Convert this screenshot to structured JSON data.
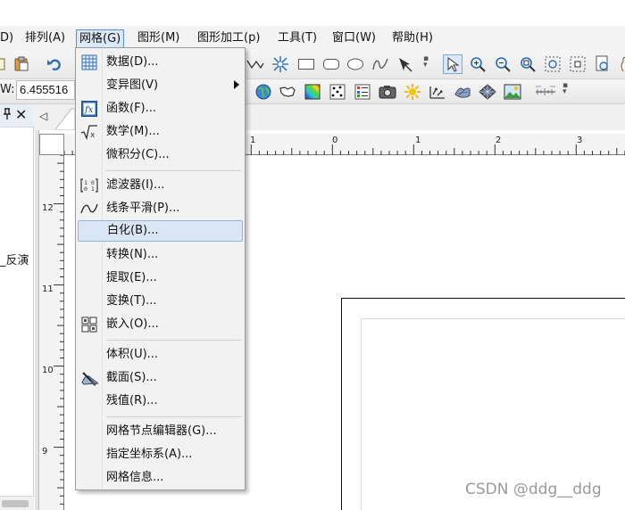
{
  "menubar": {
    "items": [
      {
        "label": "D)",
        "key": "partial"
      },
      {
        "label": "排列(A)"
      },
      {
        "label": "网格(G)"
      },
      {
        "label": "图形(M)"
      },
      {
        "label": "图形加工(p)"
      },
      {
        "label": "工具(T)"
      },
      {
        "label": "窗口(W)"
      },
      {
        "label": "帮助(H)"
      }
    ]
  },
  "toolbar": {
    "w_label": "W:",
    "w_value": "6.455516"
  },
  "left_panel": {
    "visible_text": "_反演"
  },
  "ruler": {
    "top_labels": [
      "1",
      "0",
      "1",
      "2",
      "3"
    ],
    "left_labels": [
      "12",
      "11",
      "10",
      "9"
    ]
  },
  "grid_menu": {
    "items": [
      {
        "label": "数据(D)...",
        "icon": "grid-data-icon"
      },
      {
        "label": "变异图(V)",
        "submenu": true
      },
      {
        "label": "函数(F)...",
        "icon": "function-fx-icon"
      },
      {
        "label": "数学(M)...",
        "icon": "math-sqrt-icon"
      },
      {
        "label": "微积分(C)..."
      },
      {
        "label": "滤波器(I)...",
        "icon": "filter-matrix-icon"
      },
      {
        "label": "线条平滑(P)...",
        "icon": "smooth-curve-icon"
      },
      {
        "label": "白化(B)...",
        "highlighted": true
      },
      {
        "label": "转换(N)..."
      },
      {
        "label": "提取(E)..."
      },
      {
        "label": "变换(T)..."
      },
      {
        "label": "嵌入(O)...",
        "icon": "mosaic-icon"
      },
      {
        "label": "体积(U)..."
      },
      {
        "label": "截面(S)...",
        "icon": "slice-icon"
      },
      {
        "label": "残值(R)..."
      },
      {
        "label": "网格节点编辑器(G)..."
      },
      {
        "label": "指定坐标系(A)..."
      },
      {
        "label": "网格信息..."
      }
    ]
  },
  "watermark": "CSDN @ddg__ddg",
  "colors": {
    "menu_highlight": "#dae6f6",
    "menu_highlight_border": "#8fb3e3",
    "open_menu_bg": "#dbe8f8"
  }
}
